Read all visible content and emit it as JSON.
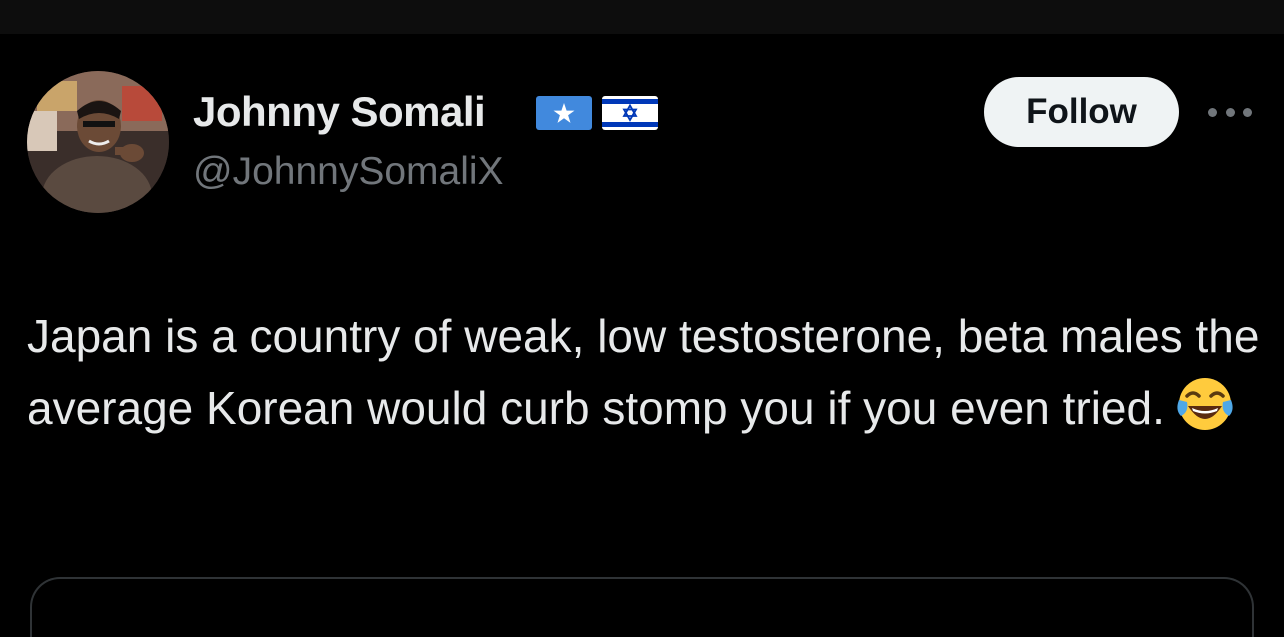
{
  "post": {
    "author": {
      "display_name": "Johnny Somali",
      "handle": "@JohnnySomaliX",
      "avatar_icon": "profile-photo",
      "name_flags": [
        "somalia-flag",
        "israel-flag"
      ]
    },
    "follow_label": "Follow",
    "more_icon": "more-options-icon",
    "text": "Japan is a country of weak, low testosterone, beta males the average Korean would curb stomp you if you even tried.",
    "emoji": "face-with-tears-of-joy"
  },
  "colors": {
    "background": "#000000",
    "primary_text": "#e7e9ea",
    "secondary_text": "#71767b",
    "follow_button_bg": "#eff3f4",
    "follow_button_text": "#0f1419",
    "border": "#2f3336"
  }
}
